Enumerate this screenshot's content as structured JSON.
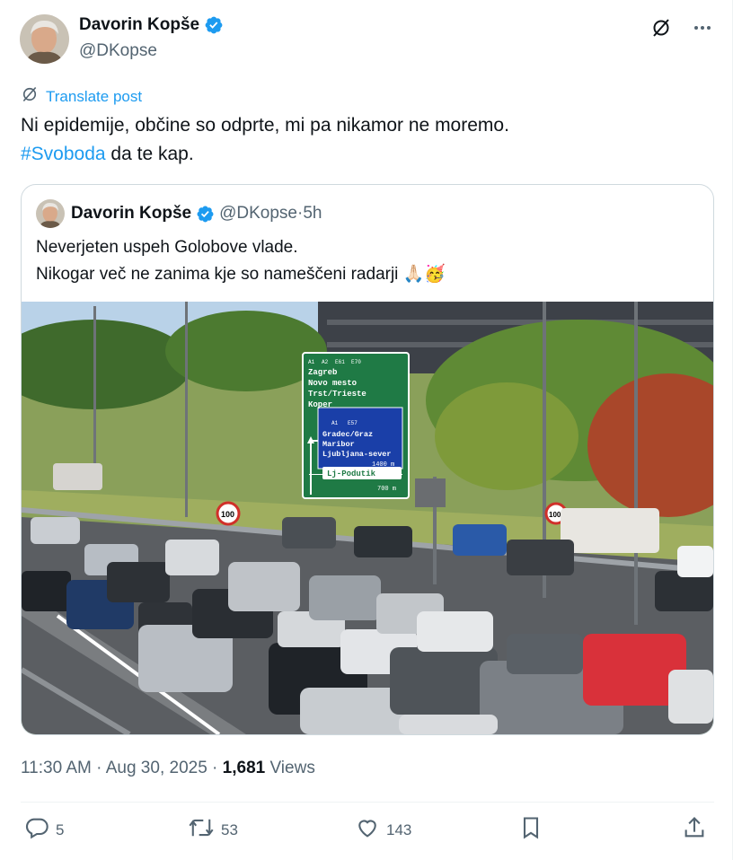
{
  "author": {
    "name": "Davorin Kopše",
    "handle": "@DKopse"
  },
  "translate_label": "Translate post",
  "post": {
    "text_line1": "Ni epidemije, občine so odprte, mi pa nikamor ne moremo.",
    "hashtag": "#Svoboda",
    "text_line2_rest": " da te kap."
  },
  "quote": {
    "name": "Davorin Kopše",
    "handle": "@DKopse",
    "separator": " · ",
    "time": "5h",
    "line1": "Neverjeten uspeh Golobove vlade.",
    "line2": "Nikogar več ne zanima kje so nameščeni radarji 🙏🏻🥳",
    "sign": {
      "top_routes": [
        "A1",
        "A2",
        "E61",
        "E70"
      ],
      "destinations_top": [
        "Zagreb",
        "Novo mesto",
        "Trst/Trieste",
        "Koper"
      ],
      "mid_routes": [
        "A1",
        "E57"
      ],
      "destinations_mid": [
        "Gradec/Graz",
        "Maribor",
        "Ljubljana-sever"
      ],
      "dist1": "1400 m",
      "exit": "Lj-Podutik",
      "dist2": "700 m",
      "speed": "100"
    }
  },
  "meta": {
    "time": "11:30 AM",
    "date": "Aug 30, 2025",
    "sep": " · ",
    "views_count": "1,681",
    "views_label": " Views"
  },
  "actions": {
    "replies": "5",
    "reposts": "53",
    "likes": "143"
  },
  "colors": {
    "accent": "#1d9bf0",
    "secondary_text": "#536471",
    "border": "#cfd9de",
    "sign_green": "#1f7a45",
    "sign_blue": "#1a3fa8"
  },
  "icons": [
    "verified-badge-icon",
    "grok-icon",
    "more-icon",
    "translate-icon",
    "reply-icon",
    "repost-icon",
    "like-icon",
    "bookmark-icon",
    "share-icon"
  ]
}
